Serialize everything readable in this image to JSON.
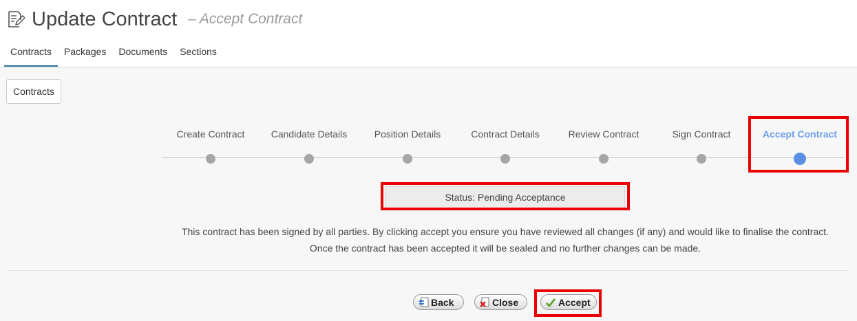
{
  "header": {
    "title": "Update Contract",
    "subtitle": "–  Accept Contract"
  },
  "tabs": [
    {
      "label": "Contracts",
      "active": true
    },
    {
      "label": "Packages"
    },
    {
      "label": "Documents"
    },
    {
      "label": "Sections"
    }
  ],
  "breadcrumb": {
    "label": "Contracts"
  },
  "steps": [
    {
      "label": "Create Contract"
    },
    {
      "label": "Candidate Details"
    },
    {
      "label": "Position Details"
    },
    {
      "label": "Contract Details"
    },
    {
      "label": "Review Contract"
    },
    {
      "label": "Sign Contract"
    },
    {
      "label": "Accept Contract",
      "current": true
    }
  ],
  "status": {
    "text": "Status: Pending Acceptance"
  },
  "message": {
    "line1": "This contract has been signed by all parties. By clicking accept you ensure you have reviewed all changes (if any) and would like to finalise the contract.",
    "line2": "Once the contract has been accepted it will be sealed and no further changes can be made."
  },
  "buttons": {
    "back": "Back",
    "close": "Close",
    "accept": "Accept"
  },
  "colors": {
    "highlight": "#ea0000",
    "current_step": "#5b8fe3",
    "tab_underline": "#2a6f97"
  },
  "icons": {
    "title": "document-edit-icon",
    "back": "back-arrow-icon",
    "close": "close-x-icon",
    "accept": "checkmark-icon"
  }
}
